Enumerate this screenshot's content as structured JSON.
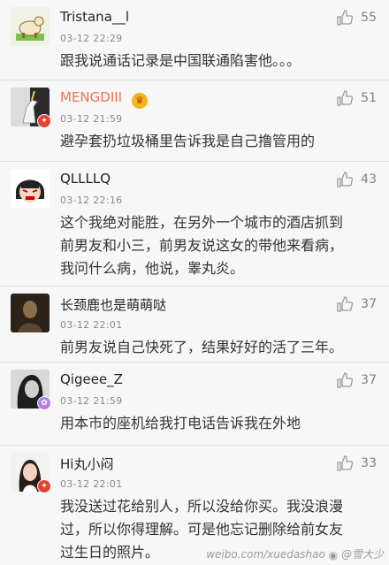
{
  "comments": [
    {
      "name": "Tristana__l",
      "time": "03-12 22:29",
      "likes": "55",
      "text": "跟我说通话记录是中国联通陷害他。。。",
      "badge": "none",
      "avatar": "horse-cartoon"
    },
    {
      "name": "MENGDIII",
      "time": "03-12 21:59",
      "likes": "51",
      "text": "避孕套扔垃圾桶里告诉我是自己撸管用的",
      "badge": "red-member",
      "avatar": "unicorn-photo",
      "vip": true
    },
    {
      "name": "QLLLLQ",
      "time": "03-12 22:16",
      "likes": "43",
      "text": "这个我绝对能胜，在另外一个城市的酒店抓到\n前男友和小三，前男友说这女的带他来看病，\n我问什么病，他说，睾丸炎。",
      "badge": "none",
      "avatar": "angry-girl-cartoon"
    },
    {
      "name": "长颈鹿也是萌萌哒",
      "time": "03-12 22:01",
      "likes": "37",
      "text": "前男友说自己快死了，结果好好的活了三年。",
      "badge": "none",
      "avatar": "painting-dark"
    },
    {
      "name": "Qigeee_Z",
      "time": "03-12 21:59",
      "likes": "37",
      "text": "用本市的座机给我打电话告诉我在外地",
      "badge": "purple-member",
      "avatar": "girl-photo-bw"
    },
    {
      "name": "Hi丸小闷",
      "time": "03-12 22:01",
      "likes": "33",
      "text": "我没送过花给别人，所以没给你买。我没浪漫\n过，所以你得理解。可是他忘记删除给前女友\n过生日的照片。",
      "badge": "red-member",
      "avatar": "girl-photo-white"
    }
  ],
  "watermark": {
    "text": "weibo.com/xuedashao",
    "handle": "@雪大少"
  },
  "colors": {
    "vip_name": "#eb7350",
    "badge_red": "#e8422f",
    "badge_purple": "#b47ce8"
  }
}
